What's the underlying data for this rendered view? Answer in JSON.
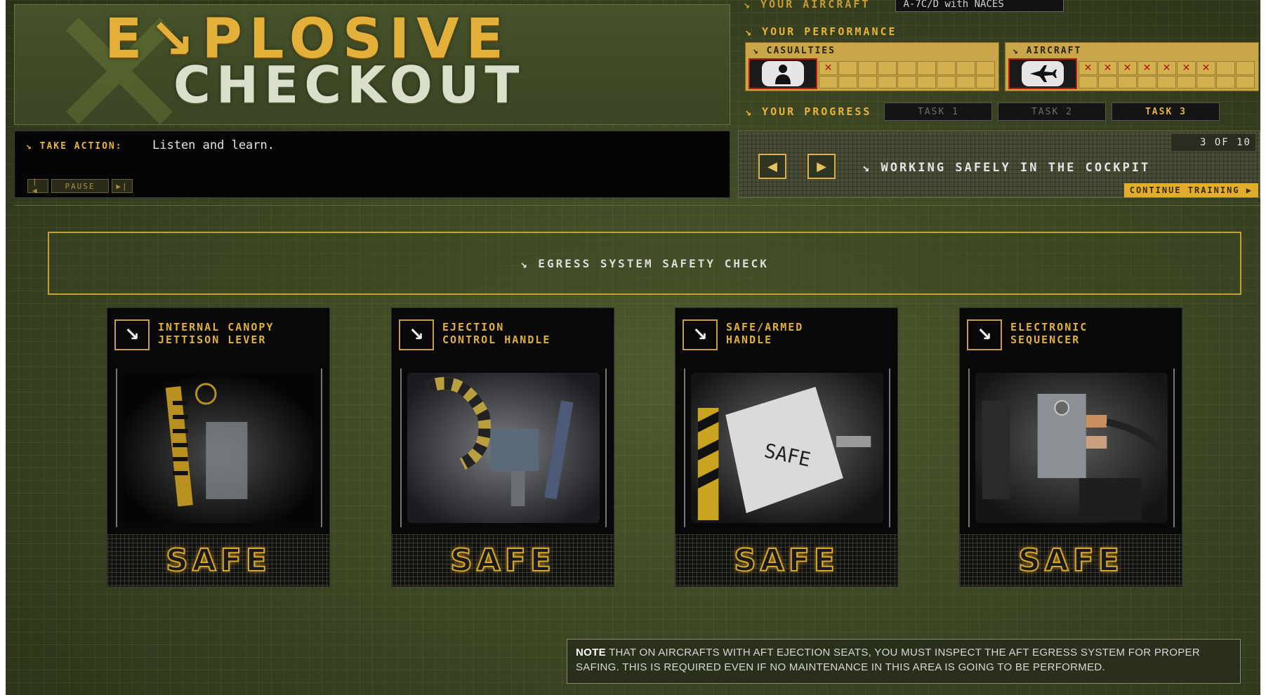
{
  "logo": {
    "line1": "E↘PLOSIVE",
    "line2": "CHECKOUT"
  },
  "header": {
    "aircraft_label": "↘ YOUR AIRCRAFT",
    "aircraft_value": "A-7C/D with NACES",
    "performance_label": "↘ YOUR PERFORMANCE",
    "casualties_label": "↘ CASUALTIES",
    "casualties_marks": [
      "x",
      "",
      "",
      "",
      "",
      "",
      "",
      "",
      ""
    ],
    "aircraft_perf_label": "↘ AIRCRAFT",
    "aircraft_marks": [
      "x",
      "x",
      "x",
      "x",
      "x",
      "x",
      "x",
      "",
      ""
    ],
    "progress_label": "↘ YOUR PROGRESS",
    "tasks": [
      {
        "label": "TASK 1",
        "state": "done"
      },
      {
        "label": "TASK 2",
        "state": "done"
      },
      {
        "label": "TASK 3",
        "state": "active"
      }
    ]
  },
  "action": {
    "label": "↘ TAKE ACTION:",
    "text": "Listen and learn.",
    "prev_label": "|◀",
    "pause_label": "PAUSE",
    "next_label": "▶|"
  },
  "nav": {
    "step_counter": "3 OF 10",
    "prev_arrow": "◀",
    "next_arrow": "▶",
    "lesson_title": "↘ WORKING SAFELY IN THE COCKPIT",
    "continue_label": "CONTINUE TRAINING ▶"
  },
  "main": {
    "banner": "↘ EGRESS SYSTEM SAFETY CHECK",
    "cards": [
      {
        "title": "INTERNAL CANOPY\nJETTISON LEVER",
        "status": "SAFE"
      },
      {
        "title": "EJECTION\nCONTROL HANDLE",
        "status": "SAFE"
      },
      {
        "title": "SAFE/ARMED\nHANDLE",
        "status": "SAFE"
      },
      {
        "title": "ELECTRONIC\nSEQUENCER",
        "status": "SAFE"
      }
    ],
    "card_photo_text": "SAFE",
    "note_bold": "NOTE",
    "note_text": " THAT ON AIRCRAFTS WITH AFT EJECTION SEATS, YOU MUST INSPECT THE AFT EGRESS SYSTEM FOR PROPER SAFING. THIS IS REQUIRED EVEN IF NO MAINTENANCE IN THIS AREA IS GOING TO BE PERFORMED."
  },
  "colors": {
    "accent": "#e3b13a",
    "background": "#3a4422",
    "x_mark": "#b01010"
  }
}
